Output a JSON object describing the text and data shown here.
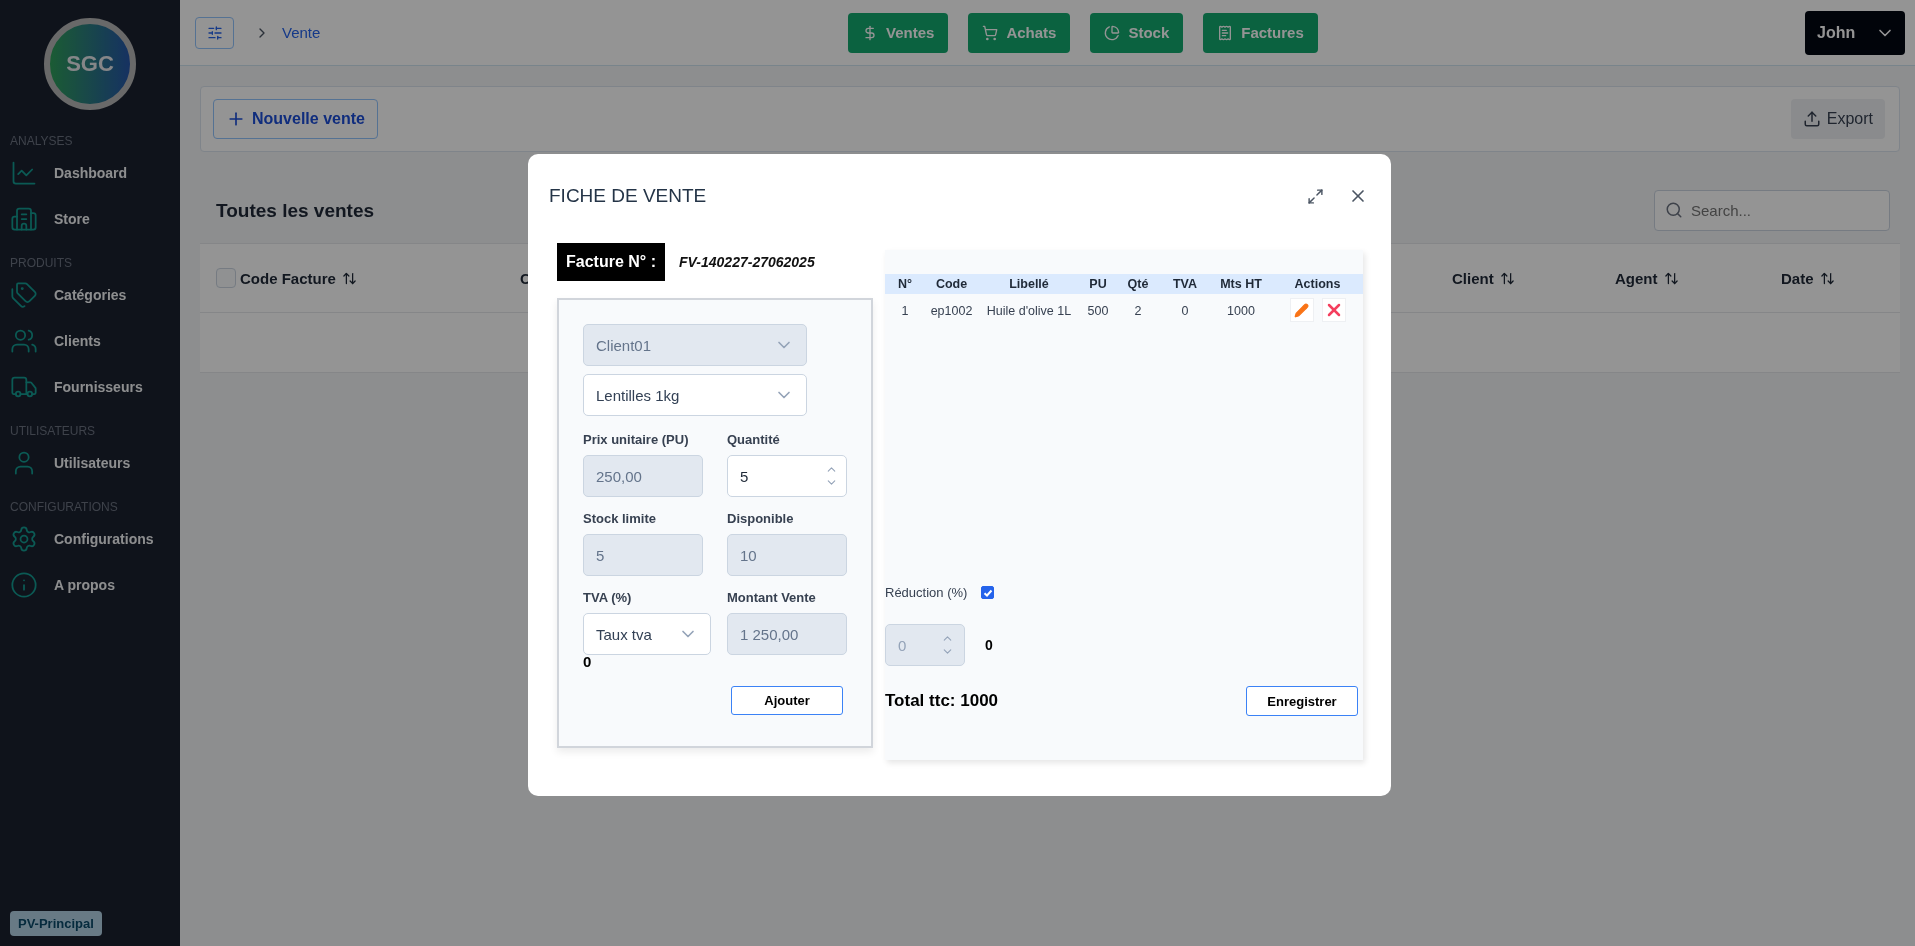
{
  "sidebar": {
    "logo": "SGC",
    "sections": [
      {
        "title": "ANALYSES",
        "items": [
          {
            "label": "Dashboard"
          },
          {
            "label": "Store"
          }
        ]
      },
      {
        "title": "PRODUITS",
        "items": [
          {
            "label": "Catégories"
          },
          {
            "label": "Clients"
          },
          {
            "label": "Fournisseurs"
          }
        ]
      },
      {
        "title": "UTILISATEURS",
        "items": [
          {
            "label": "Utilisateurs"
          }
        ]
      },
      {
        "title": "CONFIGURATIONS",
        "items": [
          {
            "label": "Configurations"
          },
          {
            "label": "A propos"
          }
        ]
      }
    ],
    "footer_badge": "PV-Principal"
  },
  "topbar": {
    "breadcrumb": "Vente",
    "nav": [
      {
        "label": "Ventes"
      },
      {
        "label": "Achats"
      },
      {
        "label": "Stock"
      },
      {
        "label": "Factures"
      }
    ],
    "user": "John"
  },
  "page": {
    "select_all": {
      "checked": false
    },
    "new_button": "Nouvelle vente",
    "export_button": "Export",
    "list_title": "Toutes les ventes",
    "search": {
      "placeholder": "Search..."
    },
    "columns": [
      {
        "label": "Code Facture",
        "sortable": true
      },
      {
        "label": "C",
        "sortable": false
      },
      {
        "label": "Client",
        "sortable": true
      },
      {
        "label": "Agent",
        "sortable": true
      },
      {
        "label": "Date",
        "sortable": true
      }
    ]
  },
  "modal": {
    "title": "FICHE DE VENTE",
    "invoice_label": "Facture N° :",
    "invoice_number": "FV-140227-27062025",
    "selects": [
      {
        "value": "Client01",
        "disabled": true
      },
      {
        "value": "Lentilles 1kg",
        "disabled": false
      }
    ],
    "fields": [
      {
        "label": "Prix unitaire (PU)",
        "value": "250,00",
        "kind": "text",
        "disabled": true
      },
      {
        "label": "Quantité",
        "value": "5",
        "kind": "number",
        "disabled": false
      },
      {
        "label": "Stock limite",
        "value": "5",
        "kind": "text",
        "disabled": true
      },
      {
        "label": "Disponible",
        "value": "10",
        "kind": "text",
        "disabled": true
      },
      {
        "label": "TVA (%)",
        "value": "Taux tva",
        "kind": "select",
        "disabled": false
      },
      {
        "label": "Montant Vente",
        "value": "1 250,00",
        "kind": "text",
        "disabled": true
      }
    ],
    "tva_total": "0",
    "add_button": "Ajouter",
    "items_table": {
      "columns": [
        "N°",
        "Code",
        "Libellé",
        "PU",
        "Qté",
        "TVA",
        "Mts HT",
        "Actions"
      ],
      "rows": [
        [
          "1",
          "ep1002",
          "Huile d'olive 1L",
          "500",
          "2",
          "0",
          "1000"
        ]
      ]
    },
    "reduction": {
      "label": "Réduction (%)",
      "checked": true,
      "value": "0",
      "disabled": true,
      "amount": "0"
    },
    "total": "Total ttc: 1000",
    "save_button": "Enregistrer"
  }
}
